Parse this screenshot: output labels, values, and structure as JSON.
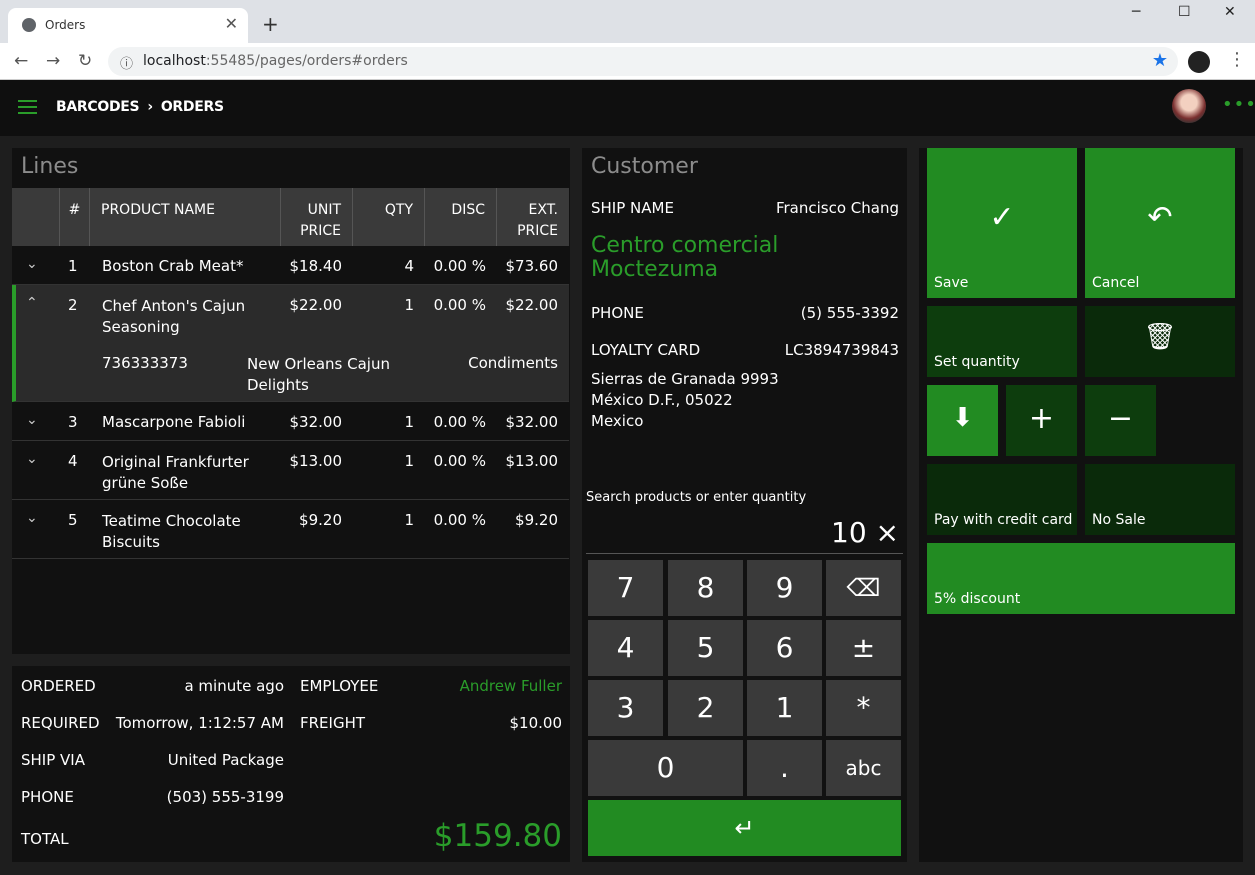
{
  "browser": {
    "tab_title": "Orders",
    "url_host": "localhost",
    "url_rest": ":55485/pages/orders#orders"
  },
  "app": {
    "breadcrumb": [
      "BARCODES",
      "ORDERS"
    ]
  },
  "lines": {
    "title": "Lines",
    "headers": {
      "num": "#",
      "name": "PRODUCT NAME",
      "unit_price_1": "UNIT",
      "unit_price_2": "PRICE",
      "qty": "QTY",
      "disc": "DISC",
      "ext_1": "EXT.",
      "ext_2": "PRICE"
    },
    "rows": [
      {
        "num": "1",
        "name": "Boston Crab Meat*",
        "name2": "",
        "price": "$18.40",
        "qty": "4",
        "disc": "0.00 %",
        "ext": "$73.60"
      },
      {
        "num": "2",
        "name": "Chef Anton's Cajun",
        "name2": "Seasoning",
        "price": "$22.00",
        "qty": "1",
        "disc": "0.00 %",
        "ext": "$22.00"
      },
      {
        "num": "3",
        "name": "Mascarpone Fabioli",
        "name2": "",
        "price": "$32.00",
        "qty": "1",
        "disc": "0.00 %",
        "ext": "$32.00"
      },
      {
        "num": "4",
        "name": "Original Frankfurter",
        "name2": "grüne Soße",
        "price": "$13.00",
        "qty": "1",
        "disc": "0.00 %",
        "ext": "$13.00"
      },
      {
        "num": "5",
        "name": "Teatime Chocolate",
        "name2": "Biscuits",
        "price": "$9.20",
        "qty": "1",
        "disc": "0.00 %",
        "ext": "$9.20"
      }
    ],
    "detail": {
      "code": "736333373",
      "supplier1": "New Orleans Cajun",
      "supplier2": "Delights",
      "category": "Condiments"
    }
  },
  "summary": {
    "ordered_label": "ORDERED",
    "ordered": "a minute ago",
    "required_label": "REQUIRED",
    "required": "Tomorrow, 1:12:57 AM",
    "shipvia_label": "SHIP VIA",
    "shipvia": "United Package",
    "phone_label": "PHONE",
    "phone": "(503) 555-3199",
    "total_label": "TOTAL",
    "total": "$159.80",
    "employee_label": "EMPLOYEE",
    "employee": "Andrew Fuller",
    "freight_label": "FREIGHT",
    "freight": "$10.00"
  },
  "customer": {
    "title": "Customer",
    "shipname_label": "SHIP NAME",
    "shipname": "Francisco Chang",
    "company1": "Centro comercial",
    "company2": "Moctezuma",
    "phone_label": "PHONE",
    "phone": "(5) 555-3392",
    "loyalty_label": "LOYALTY CARD",
    "loyalty": "LC3894739843",
    "addr1": "Sierras de Granada 9993",
    "addr2": "México D.F., 05022",
    "addr3": "Mexico"
  },
  "search": {
    "label": "Search products or enter quantity",
    "value": "10 ×"
  },
  "keypad": {
    "k7": "7",
    "k8": "8",
    "k9": "9",
    "k4": "4",
    "k5": "5",
    "k6": "6",
    "pm": "±",
    "k3": "3",
    "k2": "2",
    "k1": "1",
    "star": "*",
    "k0": "0",
    "dot": ".",
    "abc": "abc",
    "enter": "↵",
    "back": "⌫"
  },
  "tiles": {
    "save": "Save",
    "cancel": "Cancel",
    "set_quantity": "Set quantity",
    "pay": "Pay with credit card",
    "nosale": "No Sale",
    "discount": "5% discount"
  },
  "colors": {
    "accent": "#228b22",
    "accent_text": "#2a9d2a"
  }
}
